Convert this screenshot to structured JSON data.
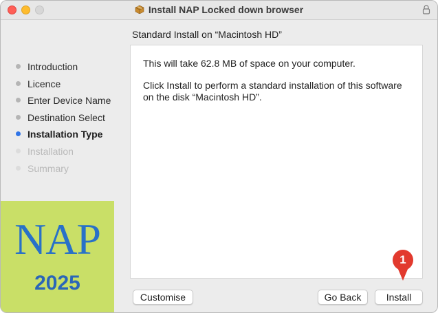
{
  "window": {
    "title": "Install NAP Locked down browser",
    "icons": [
      "package-icon",
      "lock-icon"
    ]
  },
  "sidebar": {
    "steps": [
      {
        "label": "Introduction",
        "state": "done"
      },
      {
        "label": "Licence",
        "state": "done"
      },
      {
        "label": "Enter Device Name",
        "state": "done"
      },
      {
        "label": "Destination Select",
        "state": "done"
      },
      {
        "label": "Installation Type",
        "state": "active"
      },
      {
        "label": "Installation",
        "state": "pending"
      },
      {
        "label": "Summary",
        "state": "pending"
      }
    ],
    "brand": {
      "name": "NAP",
      "year": "2025"
    }
  },
  "content": {
    "heading": "Standard Install on “Macintosh HD”",
    "line1": "This will take 62.8 MB of space on your computer.",
    "line2": "Click Install to perform a standard installation of this software on the disk “Macintosh HD”."
  },
  "buttons": {
    "customise": "Customise",
    "go_back": "Go Back",
    "install": "Install"
  },
  "annotation": {
    "number": "1"
  },
  "colors": {
    "active_step": "#2f74e7",
    "brand_bg": "#c9df67",
    "brand_text": "#2871c8",
    "marker": "#e23a2e"
  }
}
